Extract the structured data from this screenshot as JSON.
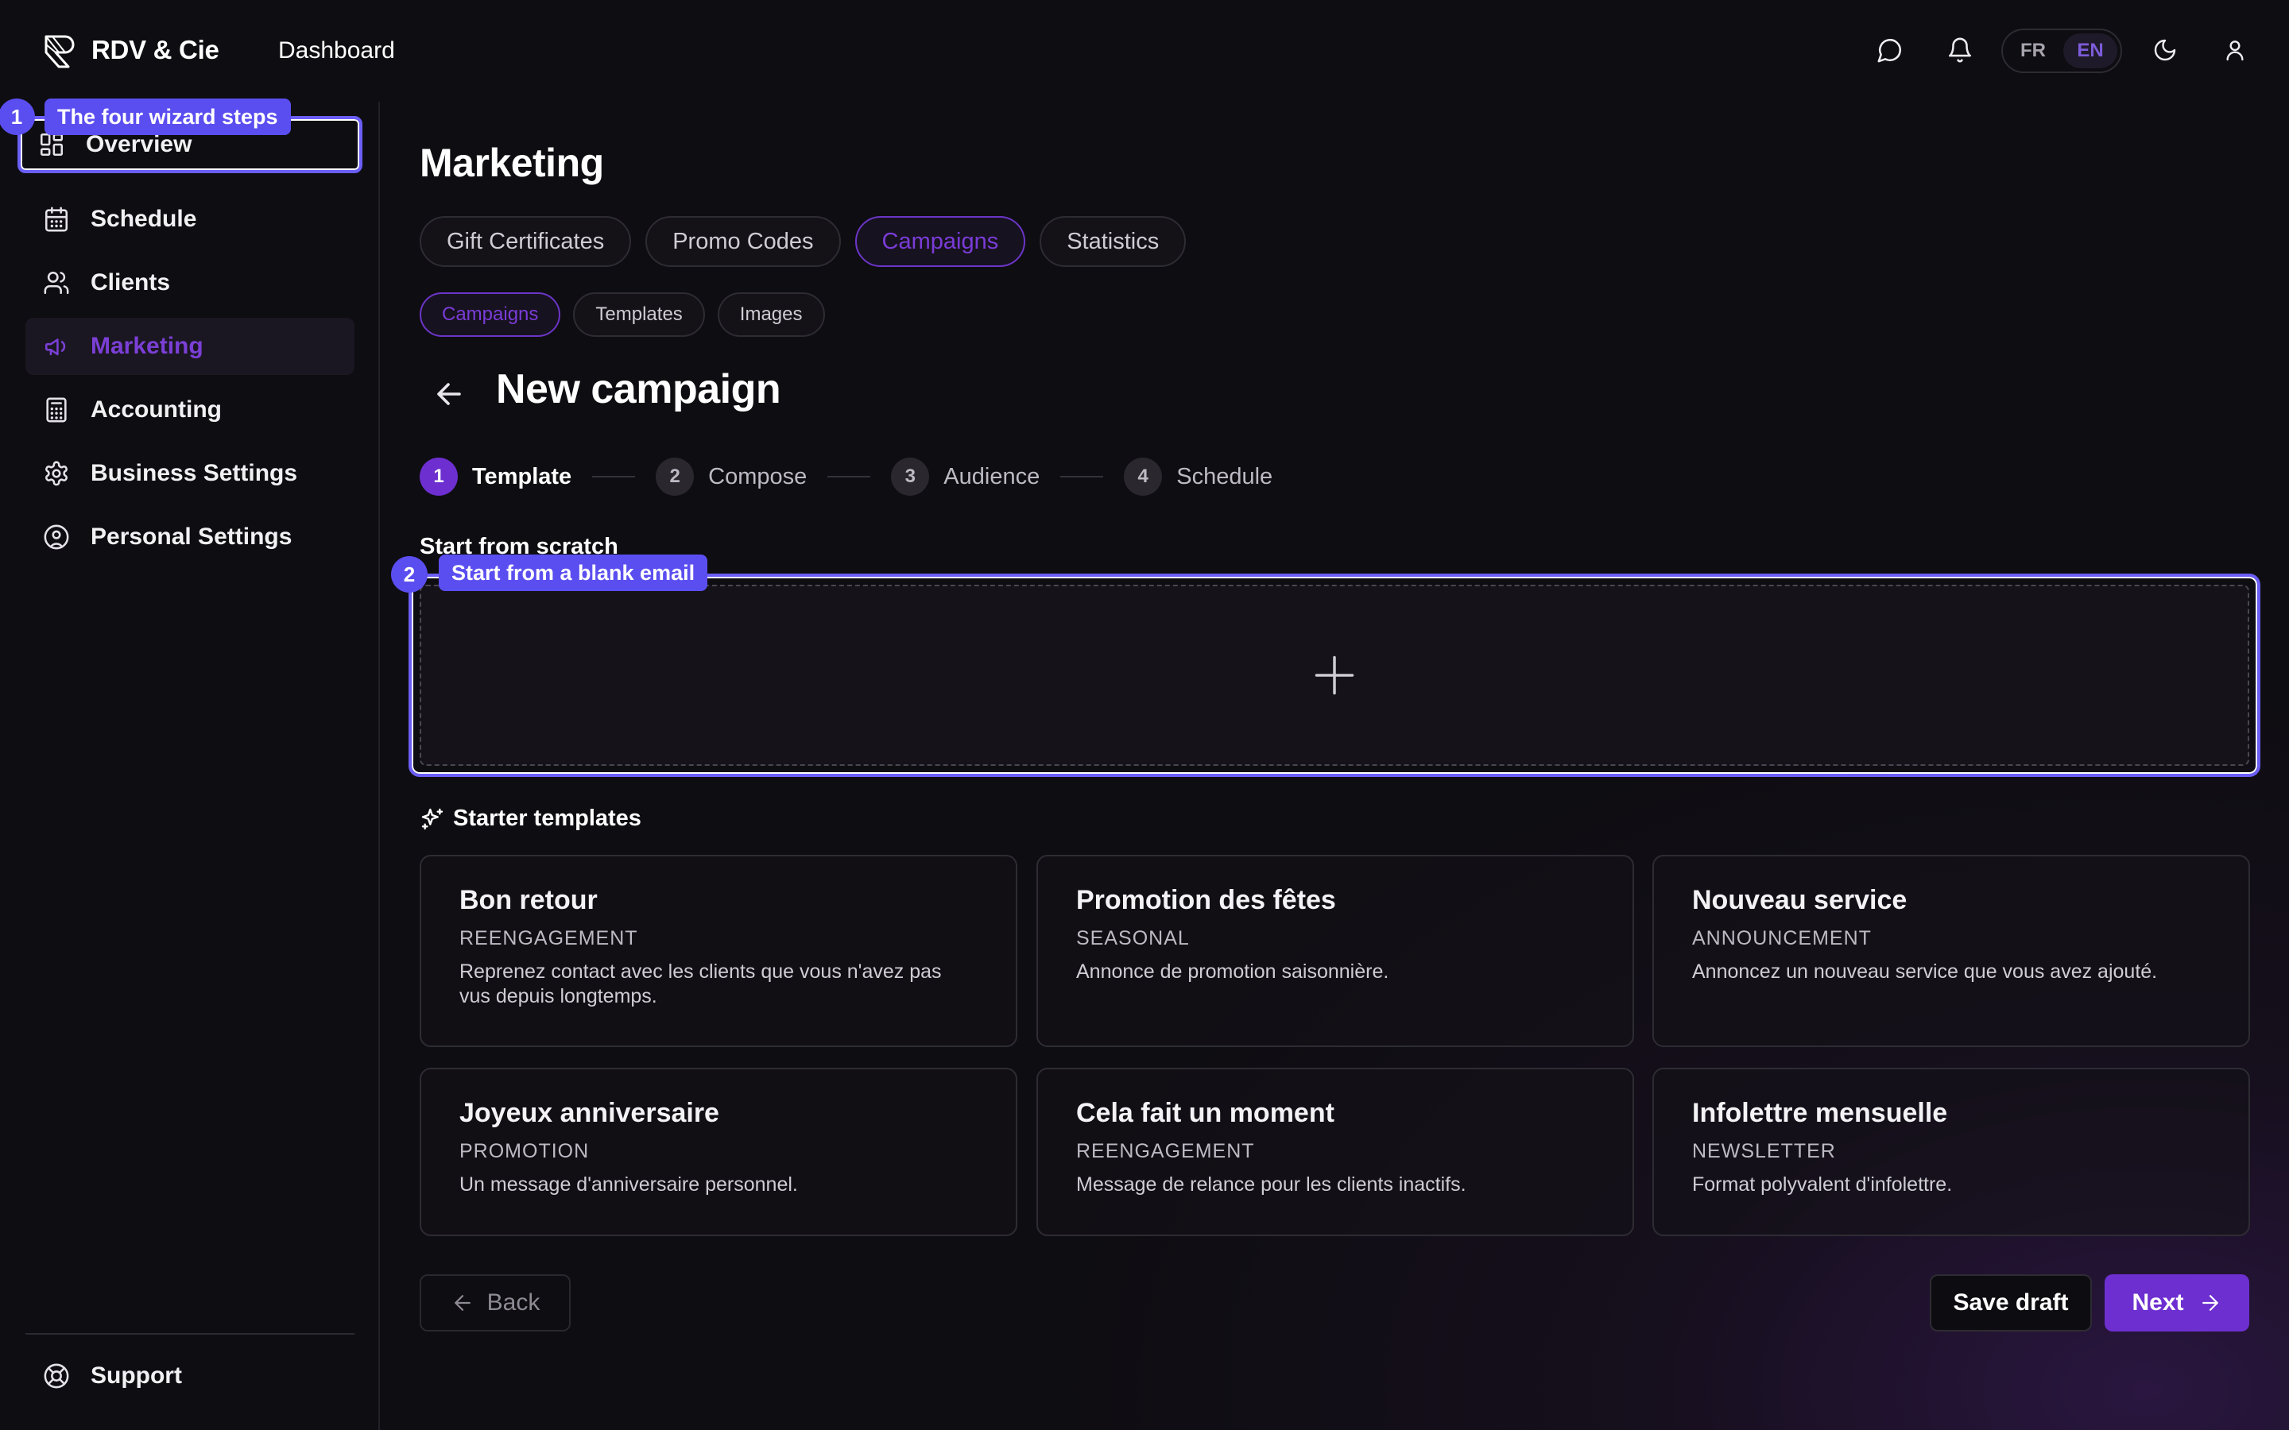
{
  "brand": {
    "name": "RDV & Cie",
    "logo_icon": "rdv-logo-icon"
  },
  "topbar": {
    "dashboard_label": "Dashboard",
    "icons": [
      "chat-icon",
      "bell-icon",
      "moon-icon",
      "user-icon"
    ],
    "languages": [
      {
        "code": "FR",
        "active": false
      },
      {
        "code": "EN",
        "active": true
      }
    ]
  },
  "sidebar": {
    "items": [
      {
        "label": "Overview",
        "icon": "grid-icon"
      },
      {
        "label": "Schedule",
        "icon": "calendar-icon"
      },
      {
        "label": "Clients",
        "icon": "users-icon"
      },
      {
        "label": "Marketing",
        "icon": "megaphone-icon",
        "active": true
      },
      {
        "label": "Accounting",
        "icon": "calculator-icon"
      },
      {
        "label": "Business Settings",
        "icon": "gear-icon"
      },
      {
        "label": "Personal Settings",
        "icon": "user-circle-icon"
      }
    ],
    "support": {
      "label": "Support",
      "icon": "lifebuoy-icon"
    }
  },
  "tour": [
    {
      "number": "1",
      "label": "The four wizard steps"
    },
    {
      "number": "2",
      "label": "Start from a blank email"
    }
  ],
  "main": {
    "title": "Marketing",
    "tabs": [
      {
        "label": "Gift Certificates",
        "active": false
      },
      {
        "label": "Promo Codes",
        "active": false
      },
      {
        "label": "Campaigns",
        "active": true
      },
      {
        "label": "Statistics",
        "active": false
      }
    ],
    "subtabs": [
      {
        "label": "Campaigns",
        "active": true
      },
      {
        "label": "Templates",
        "active": false
      },
      {
        "label": "Images",
        "active": false
      }
    ],
    "page_heading": "New campaign",
    "steps": [
      {
        "number": "1",
        "label": "Template",
        "active": true
      },
      {
        "number": "2",
        "label": "Compose",
        "active": false
      },
      {
        "number": "3",
        "label": "Audience",
        "active": false
      },
      {
        "number": "4",
        "label": "Schedule",
        "active": false
      }
    ],
    "scratch_label": "Start from scratch",
    "starter_label": "Starter templates",
    "templates": [
      {
        "title": "Bon retour",
        "category": "REENGAGEMENT",
        "description": "Reprenez contact avec les clients que vous n'avez pas vus depuis longtemps."
      },
      {
        "title": "Promotion des fêtes",
        "category": "SEASONAL",
        "description": "Annonce de promotion saisonnière."
      },
      {
        "title": "Nouveau service",
        "category": "ANNOUNCEMENT",
        "description": "Annoncez un nouveau service que vous avez ajouté."
      },
      {
        "title": "Joyeux anniversaire",
        "category": "PROMOTION",
        "description": "Un message d'anniversaire personnel."
      },
      {
        "title": "Cela fait un moment",
        "category": "REENGAGEMENT",
        "description": "Message de relance pour les clients inactifs."
      },
      {
        "title": "Infolettre mensuelle",
        "category": "NEWSLETTER",
        "description": "Format polyvalent d'infolettre."
      }
    ],
    "buttons": {
      "back": "Back",
      "save_draft": "Save draft",
      "next": "Next"
    }
  },
  "colors": {
    "accent": "#6d2fd0",
    "tour": "#5b4ef0",
    "background": "#0e0d11"
  }
}
